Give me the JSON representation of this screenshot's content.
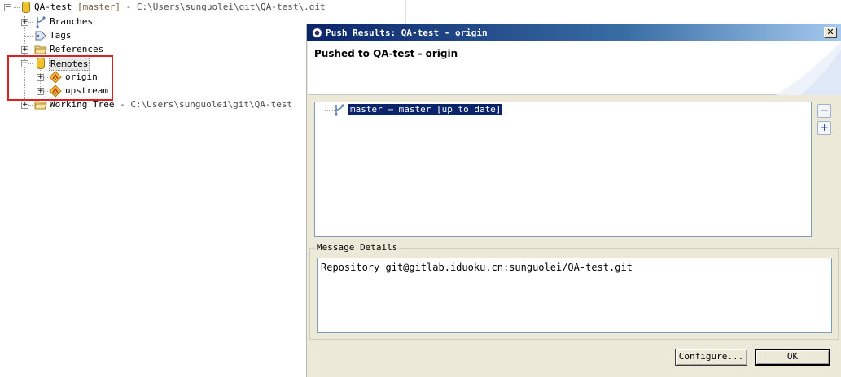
{
  "tree": {
    "root": {
      "name": "QA-test",
      "branch": "[master]",
      "path": "- C:\\Users\\sunguolei\\git\\QA-test\\.git"
    },
    "items": [
      {
        "label": "Branches",
        "icon": "branches-icon"
      },
      {
        "label": "Tags",
        "icon": "tags-icon"
      },
      {
        "label": "References",
        "icon": "folder-icon"
      },
      {
        "label": "Remotes",
        "icon": "repository-icon"
      },
      {
        "label": "Working Tree",
        "path": "- C:\\Users\\sunguolei\\git\\QA-test",
        "icon": "folder-icon"
      }
    ],
    "remotes": [
      {
        "label": "origin",
        "icon": "remote-icon"
      },
      {
        "label": "upstream",
        "icon": "remote-icon"
      }
    ],
    "toggle_collapsed": "+",
    "toggle_expanded": "−"
  },
  "dialog": {
    "title": "Push Results: QA-test - origin",
    "close_symbol": "✕",
    "banner_title": "Pushed to QA-test - origin",
    "result_line": "master → master [up to date]",
    "collapse_all": "−",
    "expand_all": "+",
    "message_legend": "Message Details",
    "message_text": "Repository git@gitlab.iduoku.cn:sunguolei/QA-test.git",
    "configure_label": "Configure...",
    "ok_label": "OK"
  },
  "colors": {
    "title_bar": "#0a246a",
    "selection": "#0a246a",
    "highlight_box": "#e02020",
    "dialog_bg": "#ece9d8"
  }
}
